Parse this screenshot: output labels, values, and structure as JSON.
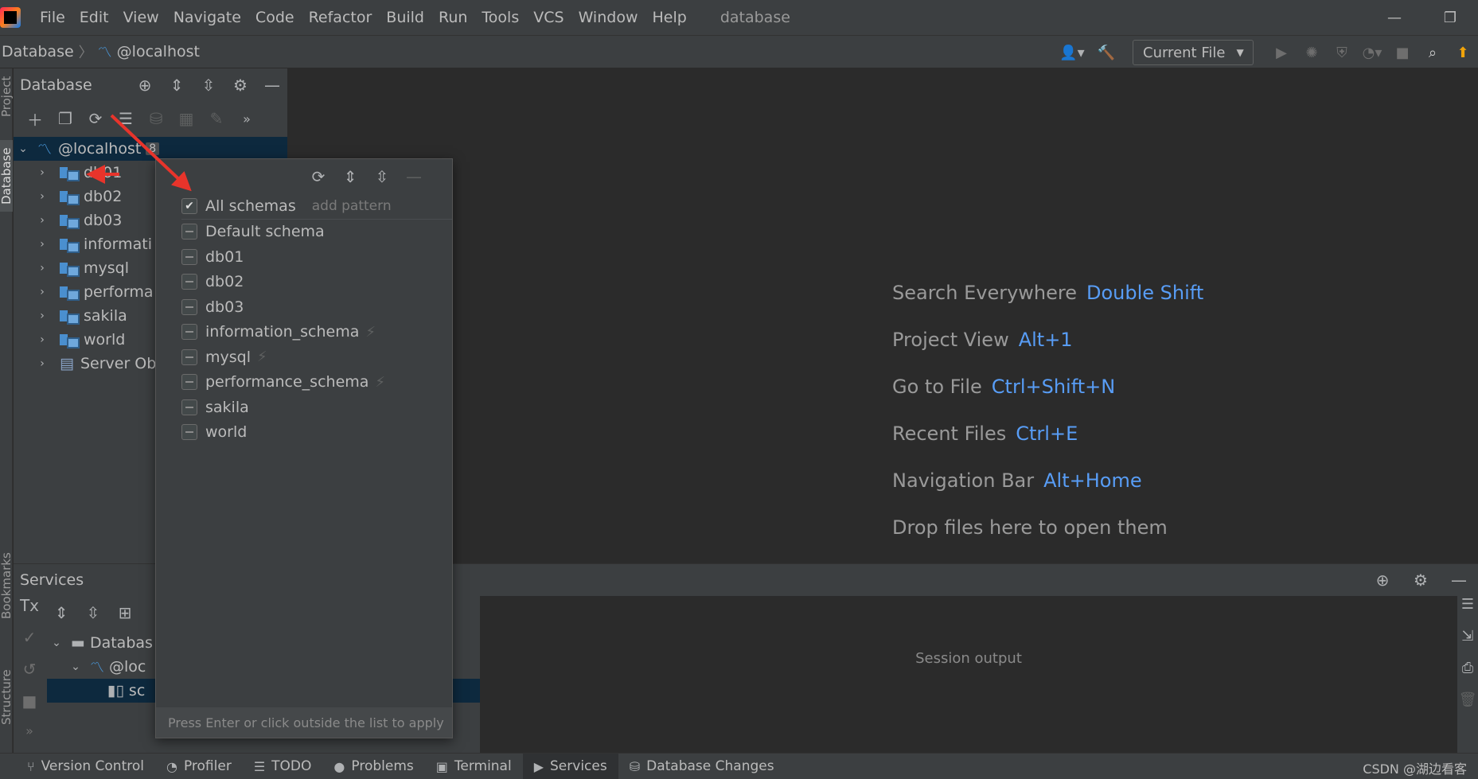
{
  "menu": {
    "items": [
      "File",
      "Edit",
      "View",
      "Navigate",
      "Code",
      "Refactor",
      "Build",
      "Run",
      "Tools",
      "VCS",
      "Window",
      "Help"
    ],
    "window_title": "database"
  },
  "navbar": {
    "breadcrumb_root": "Database",
    "breadcrumb_host": "@localhost",
    "run_config": "Current File"
  },
  "left_strip": {
    "tabs": [
      "Project",
      "Database",
      "Bookmarks",
      "Structure"
    ]
  },
  "db_panel": {
    "title": "Database",
    "host": "@localhost",
    "host_count": "8",
    "tree": [
      "db01",
      "db02",
      "db03",
      "informati",
      "mysql",
      "performa",
      "sakila",
      "world",
      "Server Ob"
    ]
  },
  "popup": {
    "all_schemas": "All schemas",
    "add_pattern": "add pattern",
    "items": [
      "Default schema",
      "db01",
      "db02",
      "db03",
      "information_schema",
      "mysql",
      "performance_schema",
      "sakila",
      "world"
    ],
    "footer": "Press Enter or click outside the list to apply"
  },
  "editor": {
    "hints": [
      {
        "label": "Search Everywhere",
        "key": "Double Shift"
      },
      {
        "label": "Project View",
        "key": "Alt+1"
      },
      {
        "label": "Go to File",
        "key": "Ctrl+Shift+N"
      },
      {
        "label": "Recent Files",
        "key": "Ctrl+E"
      },
      {
        "label": "Navigation Bar",
        "key": "Alt+Home"
      },
      {
        "label": "Drop files here to open them",
        "key": ""
      }
    ]
  },
  "services": {
    "title": "Services",
    "tree": [
      "Databas",
      "@loc",
      "sc"
    ],
    "session_output": "Session output"
  },
  "statusbar": {
    "items": [
      "Version Control",
      "Profiler",
      "TODO",
      "Problems",
      "Terminal",
      "Services",
      "Database Changes"
    ],
    "watermark": "CSDN @湖边看客"
  },
  "colors": {
    "accent": "#589df6",
    "arrow": "#e8342b",
    "selection": "#0d293e"
  }
}
